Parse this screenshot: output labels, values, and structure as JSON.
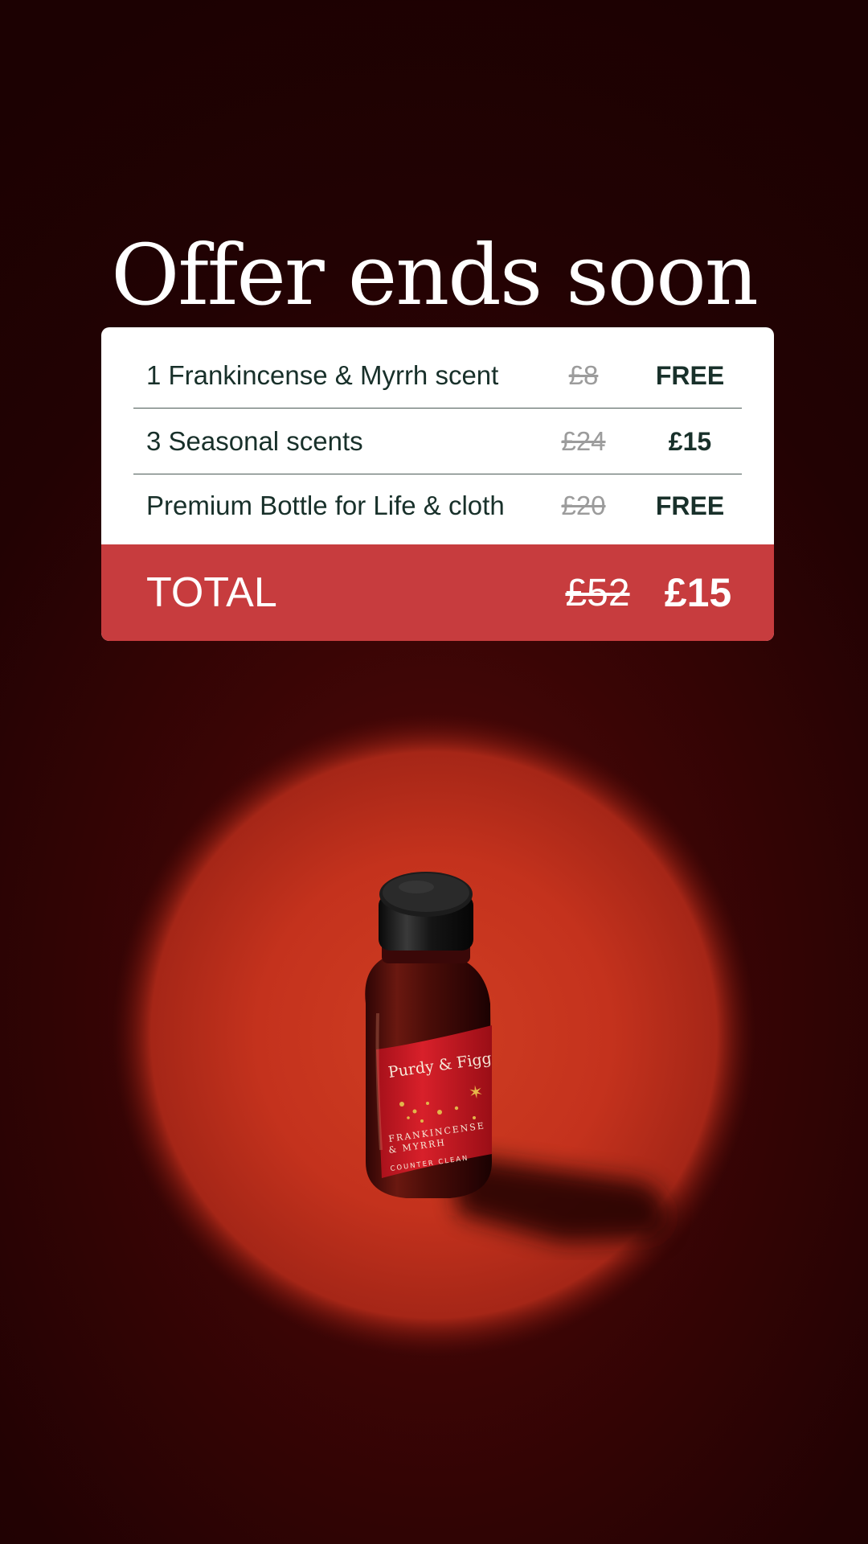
{
  "headline": "Offer ends soon",
  "offer": {
    "items": [
      {
        "name": "1 Frankincense & Myrrh scent",
        "old_price": "£8",
        "new_price": "FREE"
      },
      {
        "name": "3 Seasonal scents",
        "old_price": "£24",
        "new_price": "£15"
      },
      {
        "name": "Premium Bottle for Life & cloth",
        "old_price": "£20",
        "new_price": "FREE"
      }
    ],
    "total": {
      "label": "TOTAL",
      "old_price": "£52",
      "new_price": "£15"
    }
  },
  "product": {
    "brand": "Purdy & Figg",
    "scent_line_1": "FRANKINCENSE",
    "scent_line_2": "& MYRRH",
    "type": "COUNTER CLEAN"
  },
  "colors": {
    "background": "#240203",
    "card": "#ffffff",
    "total_bar": "#c73c3e",
    "text_dark": "#18302a",
    "strike_grey": "#9c9c9c",
    "spotlight": "#c8321e",
    "label_red": "#c0161e"
  }
}
